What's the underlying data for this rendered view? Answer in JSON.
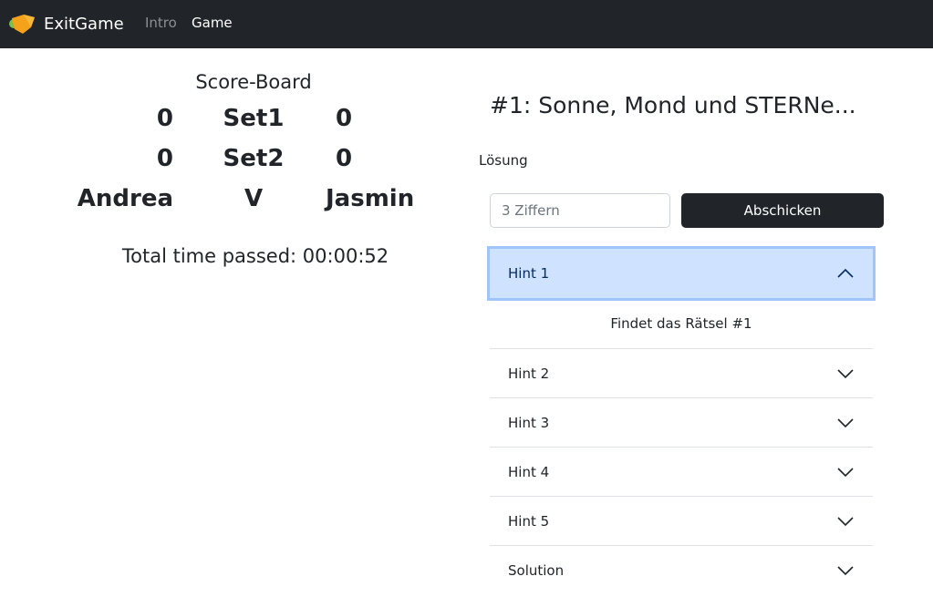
{
  "navbar": {
    "brand": "ExitGame",
    "links": [
      "Intro",
      "Game"
    ],
    "active": "Game"
  },
  "scoreboard": {
    "title": "Score-Board",
    "rows": [
      {
        "left": "0",
        "label": "Set1",
        "right": "0"
      },
      {
        "left": "0",
        "label": "Set2",
        "right": "0"
      }
    ],
    "players": {
      "left": "Andrea",
      "vs": "V",
      "right": "Jasmin"
    },
    "total_time": "Total time passed: 00:00:52"
  },
  "riddle": {
    "title": "#1: Sonne, Mond und STERNe...",
    "solution_label": "Lösung",
    "input_placeholder": "3 Ziffern",
    "input_value": "",
    "submit_label": "Abschicken"
  },
  "hints": [
    {
      "label": "Hint 1",
      "open": true,
      "body": "Findet das Rätsel #1"
    },
    {
      "label": "Hint 2",
      "open": false
    },
    {
      "label": "Hint 3",
      "open": false
    },
    {
      "label": "Hint 4",
      "open": false
    },
    {
      "label": "Hint 5",
      "open": false
    },
    {
      "label": "Solution",
      "open": false
    }
  ],
  "colors": {
    "navbar_bg": "#212529",
    "accent_open": "#cfe2ff",
    "logo": "#f4a21a"
  }
}
